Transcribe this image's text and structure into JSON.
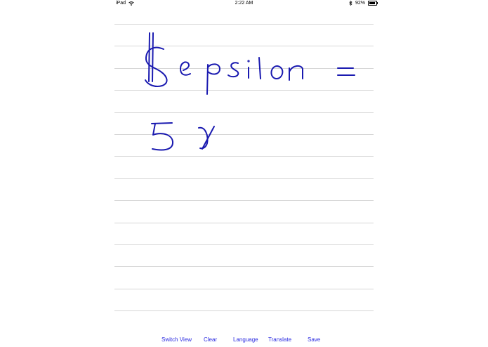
{
  "status_bar": {
    "device": "iPad",
    "time": "2:22 AM",
    "battery_text": "92%",
    "battery_level": 0.92,
    "icons": [
      "wifi-icon",
      "bluetooth-icon",
      "battery-icon"
    ]
  },
  "notepad": {
    "ruled_line_count": 14,
    "ink_color": "#1a1ab0",
    "line_color": "#d6d6d6"
  },
  "toolbar": {
    "switch_view_label": "Switch View",
    "clear_label": "Clear",
    "language_label": "Language",
    "translate_label": "Translate",
    "save_label": "Save",
    "accent_color": "#2a2ae0"
  }
}
